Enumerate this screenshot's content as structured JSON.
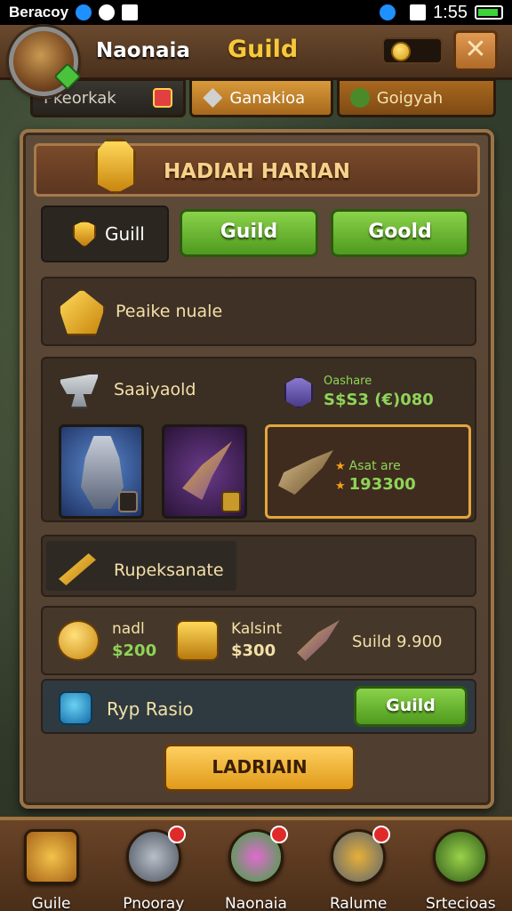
{
  "status_bar": {
    "carrier": "Beracoy",
    "time": "1:55"
  },
  "header": {
    "player_name": "Naonaia",
    "title": "Guild"
  },
  "tabs": [
    {
      "label": "Pkeorkak"
    },
    {
      "label": "Ganakioa"
    },
    {
      "label": "Goigyah"
    }
  ],
  "panel": {
    "title": "HADIAH HARIAN",
    "guild_box_label": "Guill",
    "btn_guild_1": "Guild",
    "btn_guild_2": "Goold",
    "row_b_label": "Peaike nuale",
    "row_c": {
      "title": "Saaiyaold",
      "sub1": "Oashare",
      "sub2": "S$S3 (€)080",
      "knight_badge": "",
      "spear_badge": "",
      "featured_line1": "Asat are",
      "featured_line2": "193300"
    },
    "row_d_label": "Rupeksanate",
    "rewards": [
      {
        "name": "nadl",
        "amount": "$200",
        "icon": "gold-coin"
      },
      {
        "name": "Kalsint",
        "amount": "$300",
        "icon": "gold-bars"
      },
      {
        "name": "Suild 9.900",
        "amount": "",
        "icon": "arrow"
      }
    ],
    "row_f_label": "Ryp Rasio",
    "btn_guild_3": "Guild",
    "cta": "LADRIAIN"
  },
  "bottom_nav": [
    {
      "label": "Guile",
      "icon": "chest-icon",
      "alert": false
    },
    {
      "label": "Pnooray",
      "icon": "axe-icon",
      "alert": true
    },
    {
      "label": "Naonaia",
      "icon": "heart-icon",
      "alert": true
    },
    {
      "label": "Ralume",
      "icon": "sword-icon",
      "alert": true
    },
    {
      "label": "Srtecioas",
      "icon": "leaf-icon",
      "alert": false
    }
  ]
}
